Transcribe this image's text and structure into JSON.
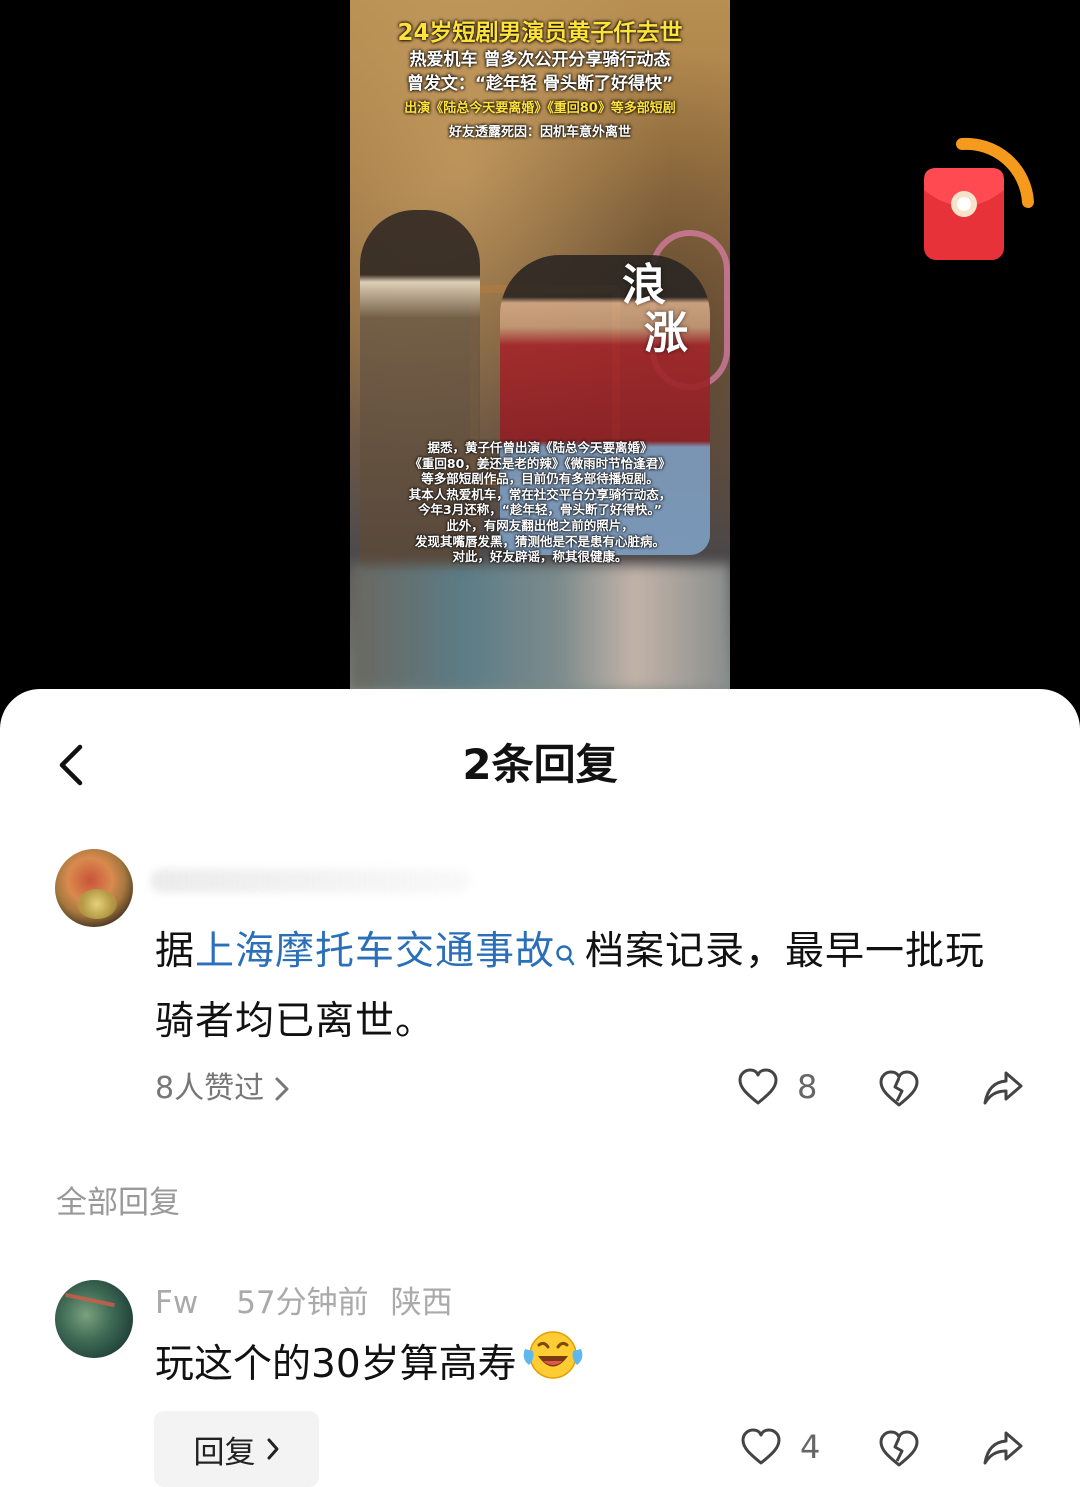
{
  "video": {
    "headline_1": "24岁短剧男演员黄子仟去世",
    "headline_2": "热爱机车 曾多次公开分享骑行动态",
    "headline_3": "曾发文：“趁年轻 骨头断了好得快”",
    "headline_4": "出演《陆总今天要离婚》《重回80》等多部短剧",
    "headline_5": "好友透露死因：因机车意外离世",
    "watermark_1": "浪",
    "watermark_2": "涨",
    "caption_lines": [
      "据悉，黄子仟曾出演《陆总今天要离婚》",
      "《重回80，姜还是老的辣》《微雨时节恰逢君》",
      "等多部短剧作品，目前仍有多部待播短剧。",
      "其本人热爱机车，常在社交平台分享骑行动态，",
      "今年3月还称，“趁年轻，骨头断了好得快。”",
      "此外，有网友翻出他之前的照片，",
      "发现其嘴唇发黑，猜测他是不是患有心脏病。",
      "对此，好友辟谣，称其很健康。"
    ]
  },
  "sheet": {
    "title": "2条回复",
    "back_icon": "chevron-left-icon"
  },
  "main_comment": {
    "text_prefix": "据",
    "link_text": "上海摩托车交通事故",
    "text_suffix": "档案记录，最早一批玩骑者均已离世。",
    "likers_label": "8人赞过",
    "like_count": "8"
  },
  "section_label": "全部回复",
  "reply": {
    "username": "Fw",
    "time": "57分钟前",
    "location": "陕西",
    "text": "玩这个的30岁算高寿",
    "reply_button": "回复",
    "like_count": "4"
  },
  "colors": {
    "link": "#2a6fb8",
    "headline_yellow": "#ffe23a",
    "redpacket": "#e8323a",
    "redpacket_arc": "#f59a1c"
  }
}
